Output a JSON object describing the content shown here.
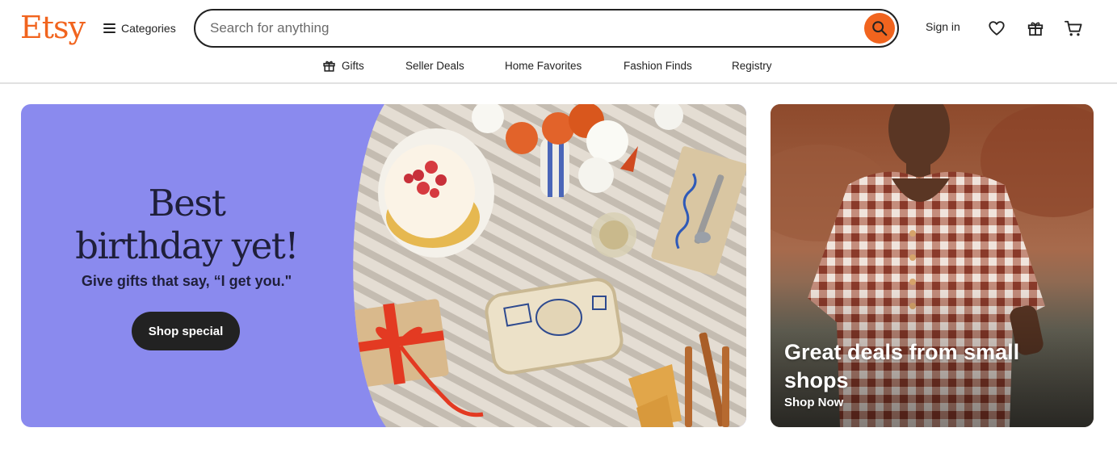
{
  "brand": {
    "logo_text": "Etsy",
    "accent_color": "#F1641E"
  },
  "header": {
    "categories_label": "Categories",
    "search": {
      "placeholder": "Search for anything",
      "value": ""
    },
    "signin_label": "Sign in",
    "icons": [
      "menu-icon",
      "search-icon",
      "heart-icon",
      "gift-icon",
      "cart-icon"
    ]
  },
  "nav": {
    "items": [
      {
        "label": "Gifts",
        "icon": "gift-icon"
      },
      {
        "label": "Seller Deals"
      },
      {
        "label": "Home Favorites"
      },
      {
        "label": "Fashion Finds"
      },
      {
        "label": "Registry"
      }
    ]
  },
  "hero": {
    "title_line1": "Best",
    "title_line2": "birthday yet!",
    "subtitle": "Give gifts that say, “I get you.\"",
    "button_label": "Shop special",
    "background_color": "#8A8AEE"
  },
  "promo": {
    "title": "Great deals from small shops",
    "link_label": "Shop Now"
  }
}
